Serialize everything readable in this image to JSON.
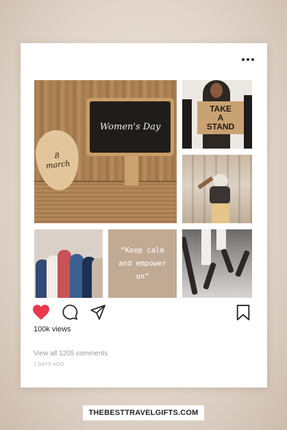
{
  "post": {
    "menu_icon": "more-dots-icon",
    "chalkboard_text": "Women's Day",
    "heart_line1": "8",
    "heart_line2": "march",
    "sign_line1": "TAKE",
    "sign_line2": "A",
    "sign_line3": "STAND",
    "quote_line1": "“Keep calm",
    "quote_line2": "and empower",
    "quote_line3": "on”",
    "views": "100k views",
    "comments_link": "View all 1205 comments",
    "posted_ago": "1 DAYS AGO"
  },
  "actions": {
    "like_icon": "heart-filled-icon",
    "comment_icon": "comment-bubble-icon",
    "share_icon": "send-icon",
    "save_icon": "bookmark-icon"
  },
  "footer": {
    "brand": "THEBESTTRAVELGIFTS.COM"
  },
  "colors": {
    "like": "#e8384c",
    "quote_tile": "#c1aa94"
  }
}
